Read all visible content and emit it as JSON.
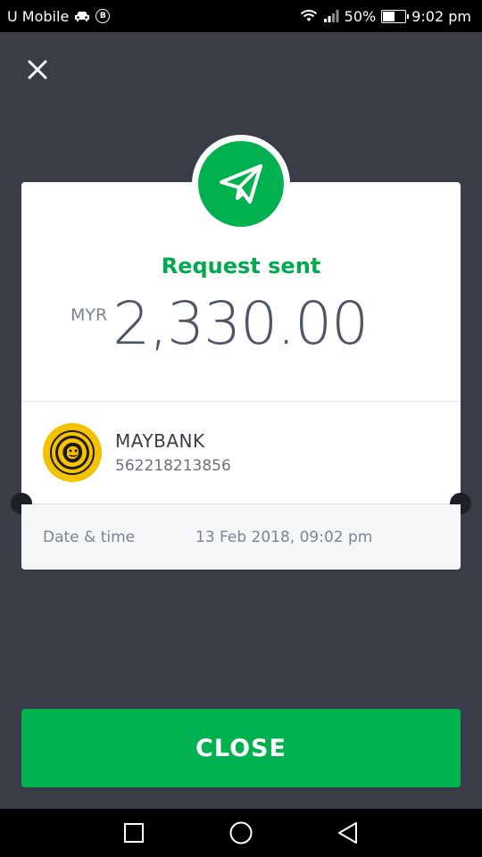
{
  "status_bar": {
    "carrier": "U Mobile",
    "battery_percent": "50%",
    "time": "9:02 pm"
  },
  "receipt": {
    "title": "Request sent",
    "currency": "MYR",
    "amount": "2,330.00",
    "recipient": {
      "bank_name": "MAYBANK",
      "account_number": "562218213856"
    },
    "date_label": "Date & time",
    "date_value": "13 Feb 2018, 09:02 pm"
  },
  "actions": {
    "close_label": "CLOSE"
  },
  "colors": {
    "accent": "#00b14f",
    "title_green": "#00a94f",
    "background": "#3a3d47",
    "bank_yellow": "#f5c200"
  }
}
